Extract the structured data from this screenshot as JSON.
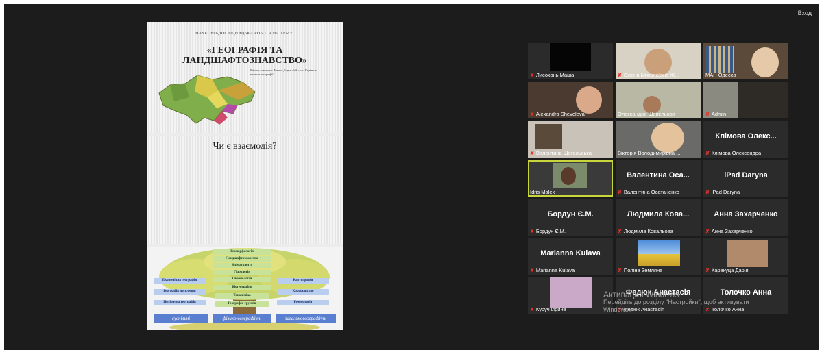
{
  "window": {
    "top_right_label": "Вход"
  },
  "shared_content": {
    "slide1": {
      "kicker": "НАУКОВО-ДОСЛІДНИЦЬКА РОБОТА НА ТЕМУ:",
      "title": "«ГЕОГРАФІЯ ТА ЛАНДШАФТОЗНАВСТВО»",
      "info": "Роботу виконала: Малюк Дарія, 6-А клас. Керівник: вчитель географії"
    },
    "slide2": {
      "question": "Чи є взаємодія?"
    },
    "slide3": {
      "labels": [
        "Геоморфологія",
        "Ландшафтознавство",
        "Кліматологія",
        "Гідрологія",
        "Океанологія",
        "Біогеографія",
        "Економічна географія",
        "Картографія",
        "Географія населення",
        "Краєзнавство",
        "Політична географія",
        "Геоекологія",
        "Топоніміка",
        "Географія грунтів"
      ],
      "categories": [
        "суспільні",
        "фізико-географічні",
        "загальногеографічні"
      ]
    }
  },
  "participants": [
    {
      "label": "Лисоконь Маша",
      "big": "",
      "video": false
    },
    {
      "label": "Олена Миколаївна Ж...",
      "big": "",
      "video": true
    },
    {
      "label": "МАН Одесса",
      "big": "",
      "video": true
    },
    {
      "label": "Alexandra Sheveleva",
      "big": "",
      "video": true
    },
    {
      "label": "Олександра Шевельова",
      "big": "",
      "video": true
    },
    {
      "label": "Admin",
      "big": "",
      "video": true
    },
    {
      "label": "Валентина Щегельська",
      "big": "",
      "video": true
    },
    {
      "label": "Вікторія Володимирівна ...",
      "big": "",
      "video": true
    },
    {
      "label": "Клімова Олександра",
      "big": "Клімова Олекс...",
      "video": false
    },
    {
      "label": "Idris Malek",
      "big": "",
      "video": true
    },
    {
      "label": "Валентина Осатаненко",
      "big": "Валентина Оса...",
      "video": false
    },
    {
      "label": "iPad Daryna",
      "big": "iPad Daryna",
      "video": false
    },
    {
      "label": "Бордун Є.М.",
      "big": "Бордун Є.М.",
      "video": false
    },
    {
      "label": "Людмила Ковальова",
      "big": "Людмила Кова...",
      "video": false
    },
    {
      "label": "Анна Захарченко",
      "big": "Анна Захарченко",
      "video": false
    },
    {
      "label": "Marianna Kulava",
      "big": "Marianna Kulava",
      "video": false
    },
    {
      "label": "Поліна Земляна",
      "big": "",
      "video": false
    },
    {
      "label": "Каракуца Дарія",
      "big": "",
      "video": false
    },
    {
      "label": "Куруч Ирина",
      "big": "",
      "video": false
    },
    {
      "label": "Федюк Анастасія",
      "big": "Федюк Анастасія",
      "video": false
    },
    {
      "label": "Толочко Анна",
      "big": "Толочко Анна",
      "video": false
    }
  ],
  "mic_icon": "mic-muted-icon",
  "watermark": {
    "line1": "Активация Windows",
    "line2": "Перейдіть до розділу \"Настройки\", щоб активувати",
    "line3": "Windows."
  }
}
